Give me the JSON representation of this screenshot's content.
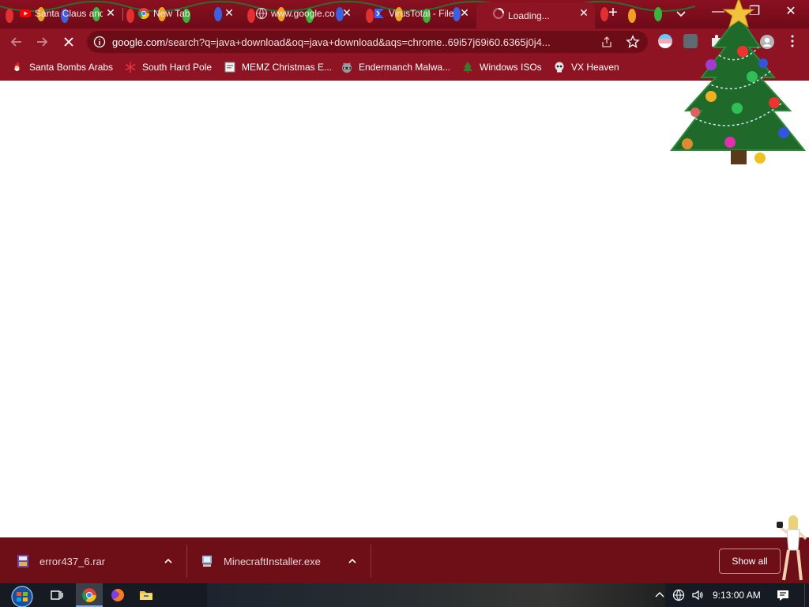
{
  "browser": {
    "tabs": [
      {
        "title": "Santa Claus and",
        "icon": "youtube-icon"
      },
      {
        "title": "New Tab",
        "icon": "chrome-icon"
      },
      {
        "title": "www.google.co",
        "icon": "globe-icon"
      },
      {
        "title": "VirusTotal - File",
        "icon": "virustotal-icon"
      },
      {
        "title": "Loading...",
        "icon": "loading-spinner-icon",
        "active": true
      }
    ],
    "tab_close_glyph": "✕",
    "new_tab_glyph": "+",
    "window_controls": {
      "minimize": "—",
      "maximize": "❐",
      "close": "✕"
    },
    "address_bar": {
      "host": "google.com",
      "path": "/search?q=java+download&oq=java+download&aqs=chrome..69i57j69i60.6365j0j4..."
    },
    "bookmarks": [
      {
        "label": "Santa Bombs Arabs",
        "icon": "santa-icon"
      },
      {
        "label": "South Hard Pole",
        "icon": "snowflake-icon"
      },
      {
        "label": "MEMZ Christmas E...",
        "icon": "page-icon"
      },
      {
        "label": "Endermanch Malwa...",
        "icon": "raccoon-icon"
      },
      {
        "label": "Windows ISOs",
        "icon": "tree-icon"
      },
      {
        "label": "VX Heaven",
        "icon": "vx-skull-icon"
      }
    ]
  },
  "downloads": {
    "items": [
      {
        "name": "error437_6.rar",
        "icon": "winrar-archive-icon"
      },
      {
        "name": "MinecraftInstaller.exe",
        "icon": "installer-exe-icon"
      }
    ],
    "show_all_label": "Show all"
  },
  "taskbar": {
    "clock": "9:13:00 AM",
    "pinned": [
      "task-view-icon",
      "chrome-icon",
      "firefox-icon",
      "file-explorer-icon"
    ],
    "tray": [
      "show-hidden-icons-chevron",
      "network-icon",
      "volume-icon",
      "action-center-icon"
    ]
  },
  "colors": {
    "theme_dark": "#6e0a18",
    "theme": "#8e1423",
    "omnibox": "#6b0c17",
    "download_shelf": "#6e0f18",
    "taskbar": "#161a22"
  }
}
